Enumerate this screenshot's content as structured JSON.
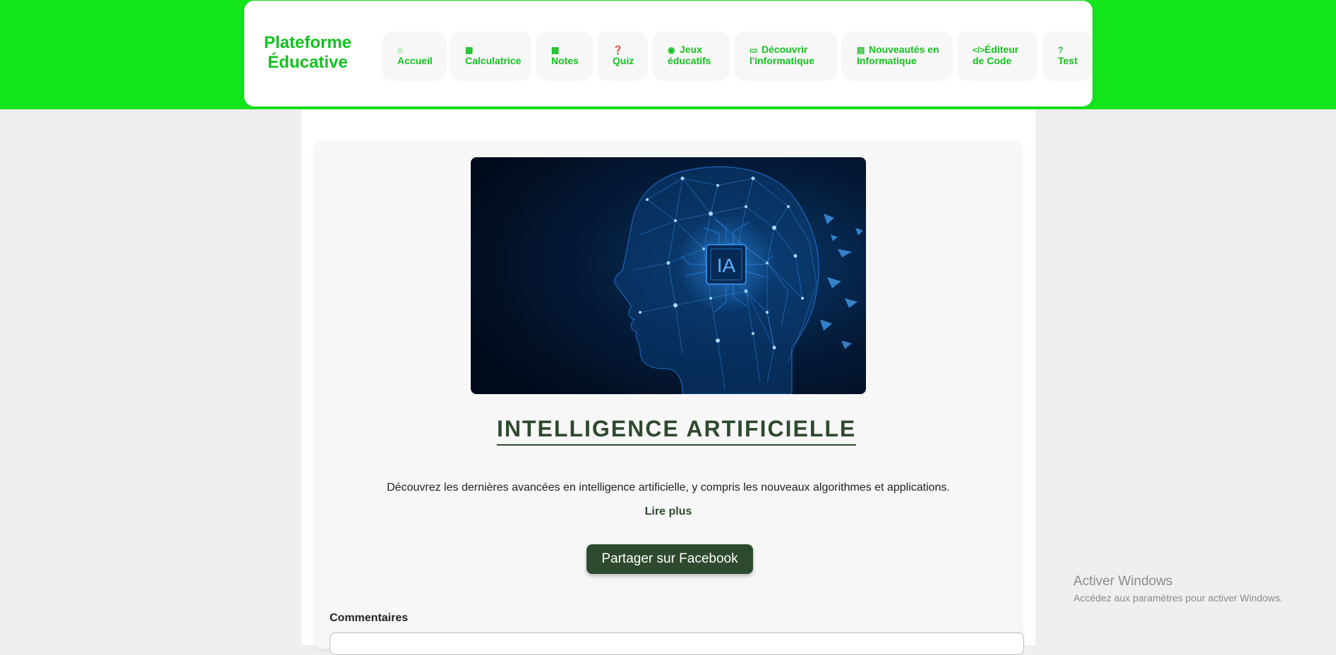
{
  "header": {
    "brand_line1": "Plateforme",
    "brand_line2": "Éducative",
    "nav": [
      {
        "icon": "home-icon",
        "line1": "",
        "line2": "Accueil"
      },
      {
        "icon": "calculator-icon",
        "line1": "",
        "line2": "Calculatrice"
      },
      {
        "icon": "note-icon",
        "line1": "",
        "line2": "Notes"
      },
      {
        "icon": "question-circle-icon",
        "line1": "",
        "line2": "Quiz"
      },
      {
        "icon": "gamepad-icon",
        "line1": "Jeux",
        "line2": "éducatifs"
      },
      {
        "icon": "laptop-icon",
        "line1": "Découvrir",
        "line2": "l'informatique"
      },
      {
        "icon": "newspaper-icon",
        "line1": "Nouveautés en",
        "line2": "Informatique"
      },
      {
        "icon": "code-icon",
        "line1": "Éditeur",
        "line2": "de Code"
      },
      {
        "icon": "question-icon",
        "line1": "",
        "line2": "Test"
      }
    ]
  },
  "article": {
    "hero_text": "IA",
    "title": "INTELLIGENCE ARTIFICIELLE",
    "description": "Découvrez les dernières avancées en intelligence artificielle, y compris les nouveaux algorithmes et applications.",
    "read_more": "Lire plus",
    "share_label": "Partager sur Facebook",
    "comments_label": "Commentaires"
  },
  "windows_watermark": {
    "title": "Activer Windows",
    "subtitle": "Accédez aux paramètres pour activer Windows."
  },
  "colors": {
    "band": "#13e61a",
    "brand": "#12c21f",
    "title": "#2e4a2e",
    "button": "#2e4a2e"
  }
}
